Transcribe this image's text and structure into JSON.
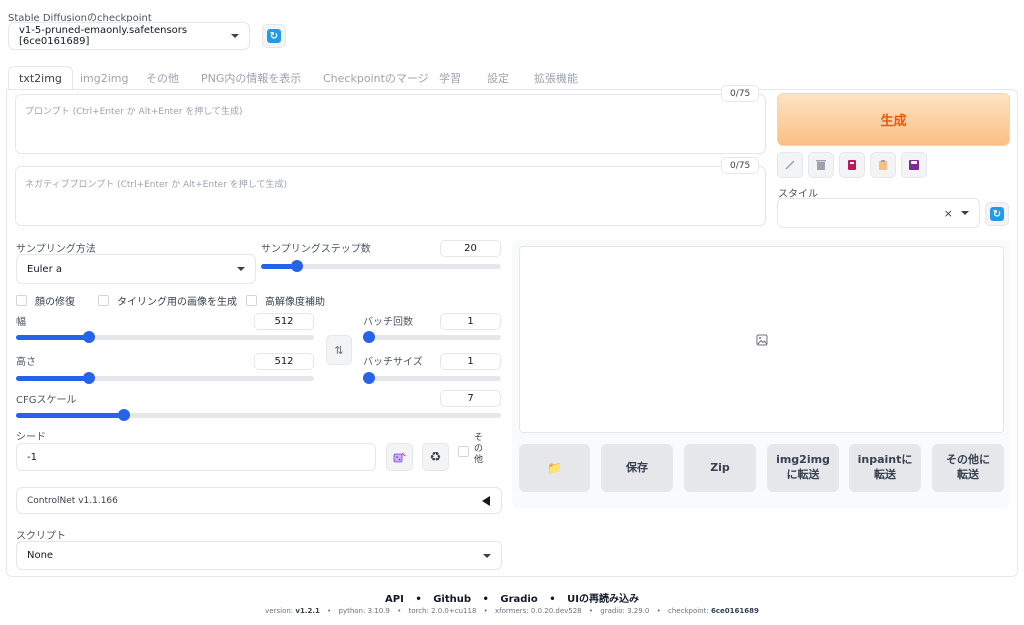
{
  "checkpoint": {
    "label": "Stable Diffusionのcheckpoint",
    "value": "v1-5-pruned-emaonly.safetensors [6ce0161689]"
  },
  "tabs": [
    {
      "label": "txt2img",
      "active": true
    },
    {
      "label": "img2img"
    },
    {
      "label": "その他"
    },
    {
      "label": "PNG内の情報を表示"
    },
    {
      "label": "Checkpointのマージ"
    },
    {
      "label": "学習"
    },
    {
      "label": "設定"
    },
    {
      "label": "拡張機能"
    }
  ],
  "prompt": {
    "placeholder": "プロンプト (Ctrl+Enter か Alt+Enter を押して生成)",
    "counter": "0/75"
  },
  "negative_prompt": {
    "placeholder": "ネガティブプロンプト (Ctrl+Enter か Alt+Enter を押して生成)",
    "counter": "0/75"
  },
  "generate": {
    "label": "生成"
  },
  "tool_icons": [
    "pencil-icon",
    "trash-icon",
    "book-icon",
    "clipboard-icon",
    "save-icon"
  ],
  "style": {
    "label": "スタイル",
    "clear": "×"
  },
  "sampling_method": {
    "label": "サンプリング方法",
    "value": "Euler a"
  },
  "sampling_steps": {
    "label": "サンプリングステップ数",
    "value": "20",
    "fraction": 0.13
  },
  "checkboxes": {
    "face_restore": "顔の修復",
    "tiling": "タイリング用の画像を生成",
    "hires_fix": "高解像度補助"
  },
  "width": {
    "label": "幅",
    "value": "512",
    "fraction": 0.235
  },
  "height": {
    "label": "高さ",
    "value": "512",
    "fraction": 0.235
  },
  "batch_count": {
    "label": "バッチ回数",
    "value": "1",
    "fraction": 0.0
  },
  "batch_size": {
    "label": "バッチサイズ",
    "value": "1",
    "fraction": 0.0
  },
  "cfg_scale": {
    "label": "CFGスケール",
    "value": "7",
    "fraction": 0.215
  },
  "seed": {
    "label": "シード",
    "value": "-1",
    "extra_label": "その他"
  },
  "controlnet": {
    "label": "ControlNet v1.1.166"
  },
  "script": {
    "label": "スクリプト",
    "value": "None"
  },
  "output_buttons": [
    {
      "name": "folder-button",
      "label": "📁"
    },
    {
      "name": "save-button",
      "label": "保存"
    },
    {
      "name": "zip-button",
      "label": "Zip"
    },
    {
      "name": "send-to-img2img-button",
      "label": "img2img\nに転送"
    },
    {
      "name": "send-to-inpaint-button",
      "label": "inpaintに\n転送"
    },
    {
      "name": "send-to-extras-button",
      "label": "その他に\n転送"
    }
  ],
  "footer": {
    "links": [
      "API",
      "Github",
      "Gradio",
      "UIの再読み込み"
    ],
    "separator": "•",
    "version_label": "version:",
    "version": "v1.2.1",
    "python": "python: 3.10.9",
    "torch": "torch: 2.0.0+cu118",
    "xformers": "xformers: 0.0.20.dev528",
    "gradio": "gradio: 3.29.0",
    "checkpoint_label": "checkpoint:",
    "checkpoint": "6ce0161689"
  }
}
